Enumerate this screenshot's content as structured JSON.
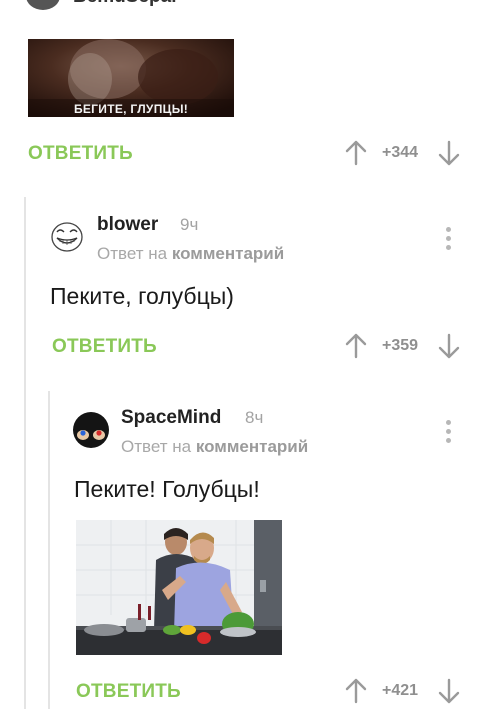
{
  "top_comment": {
    "username": "BemuSepai",
    "gif_caption": "БЕГИТЕ, ГЛУПЦЫ!",
    "reply_label": "ОТВЕТИТЬ",
    "rating": "+344"
  },
  "comment_blower": {
    "username": "blower",
    "time": "9ч",
    "reply_to_prefix": "Ответ на",
    "reply_to_link": "комментарий",
    "text": "Пеките, голубцы)",
    "reply_label": "ОТВЕТИТЬ",
    "rating": "+359"
  },
  "comment_spacemind": {
    "username": "SpaceMind",
    "time": "8ч",
    "reply_to_prefix": "Ответ на",
    "reply_to_link": "комментарий",
    "text": "Пеките! Голубцы!",
    "reply_label": "ОТВЕТИТЬ",
    "rating": "+421"
  },
  "colors": {
    "accent_green": "#8ac858",
    "muted_gray": "#a3a3a3",
    "thread_line": "#e4e4e4"
  },
  "icons": [
    "upvote-arrow-icon",
    "downvote-arrow-icon",
    "more-dots-icon",
    "avatar"
  ]
}
